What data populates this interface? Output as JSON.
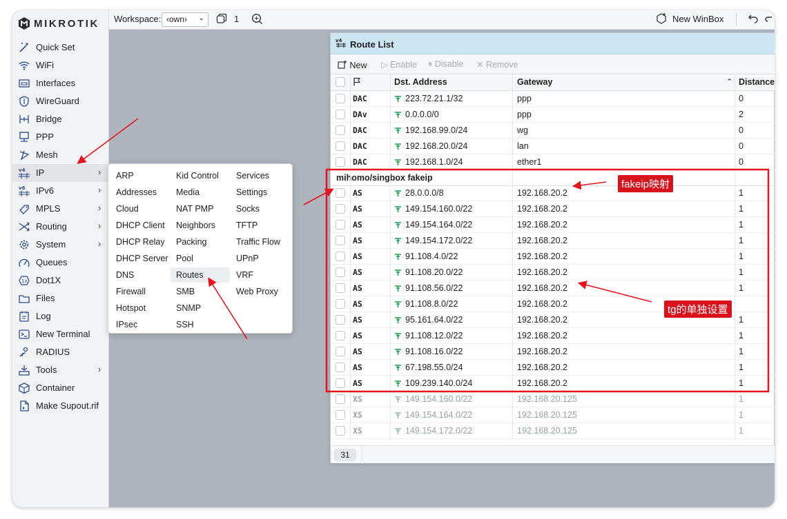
{
  "brand": {
    "name": "MIKROTIK"
  },
  "topbar": {
    "workspace_label": "Workspace:",
    "workspace_value": "‹own›",
    "windows_count": "1",
    "new_winbox": "New WinBox"
  },
  "sidebar": {
    "items": [
      {
        "label": "Quick Set",
        "icon": "quick-set-icon"
      },
      {
        "label": "WiFi",
        "icon": "wifi-icon"
      },
      {
        "label": "Interfaces",
        "icon": "interfaces-icon"
      },
      {
        "label": "WireGuard",
        "icon": "wireguard-icon"
      },
      {
        "label": "Bridge",
        "icon": "bridge-icon"
      },
      {
        "label": "PPP",
        "icon": "ppp-icon"
      },
      {
        "label": "Mesh",
        "icon": "mesh-icon"
      },
      {
        "label": "IP",
        "icon": "ip-icon",
        "submenu": true
      },
      {
        "label": "IPv6",
        "icon": "ipv6-icon",
        "submenu": true
      },
      {
        "label": "MPLS",
        "icon": "mpls-icon",
        "submenu": true
      },
      {
        "label": "Routing",
        "icon": "routing-icon",
        "submenu": true
      },
      {
        "label": "System",
        "icon": "system-icon",
        "submenu": true
      },
      {
        "label": "Queues",
        "icon": "queues-icon"
      },
      {
        "label": "Dot1X",
        "icon": "dot1x-icon"
      },
      {
        "label": "Files",
        "icon": "files-icon"
      },
      {
        "label": "Log",
        "icon": "log-icon"
      },
      {
        "label": "New Terminal",
        "icon": "terminal-icon"
      },
      {
        "label": "RADIUS",
        "icon": "radius-icon"
      },
      {
        "label": "Tools",
        "icon": "tools-icon",
        "submenu": true
      },
      {
        "label": "Container",
        "icon": "container-icon"
      },
      {
        "label": "Make Supout.rif",
        "icon": "supout-icon"
      }
    ]
  },
  "ip_menu": {
    "columns": [
      [
        "ARP",
        "Addresses",
        "Cloud",
        "DHCP Client",
        "DHCP Relay",
        "DHCP Server",
        "DNS",
        "Firewall",
        "Hotspot",
        "IPsec"
      ],
      [
        "Kid Control",
        "Media",
        "NAT PMP",
        "Neighbors",
        "Packing",
        "Pool",
        "Routes",
        "SMB",
        "SNMP",
        "SSH"
      ],
      [
        "Services",
        "Settings",
        "Socks",
        "TFTP",
        "Traffic Flow",
        "UPnP",
        "VRF",
        "Web Proxy"
      ]
    ],
    "highlighted": "Routes"
  },
  "route_list": {
    "title": "Route List",
    "toolbar": {
      "new": "New",
      "enable": "Enable",
      "disable": "Disable",
      "remove": "Remove"
    },
    "columns": {
      "dst": "Dst. Address",
      "gateway": "Gateway",
      "distance": "Distance"
    },
    "rows": [
      {
        "flags": "DAC",
        "dst": "223.72.21.1/32",
        "gateway": "ppp",
        "distance": "0"
      },
      {
        "flags": "DAv",
        "dst": "0.0.0.0/0",
        "gateway": "ppp",
        "distance": "2"
      },
      {
        "flags": "DAC",
        "dst": "192.168.99.0/24",
        "gateway": "wg",
        "distance": "0"
      },
      {
        "flags": "DAC",
        "dst": "192.168.20.0/24",
        "gateway": "lan",
        "distance": "0"
      },
      {
        "flags": "DAC",
        "dst": "192.168.1.0/24",
        "gateway": "ether1",
        "distance": "0"
      }
    ],
    "group": "mihomo/singbox fakeip",
    "group_rows": [
      {
        "flags": "AS",
        "dst": "28.0.0.0/8",
        "gateway": "192.168.20.2",
        "distance": "1"
      },
      {
        "flags": "AS",
        "dst": "149.154.160.0/22",
        "gateway": "192.168.20.2",
        "distance": "1"
      },
      {
        "flags": "AS",
        "dst": "149.154.164.0/22",
        "gateway": "192.168.20.2",
        "distance": "1"
      },
      {
        "flags": "AS",
        "dst": "149.154.172.0/22",
        "gateway": "192.168.20.2",
        "distance": "1"
      },
      {
        "flags": "AS",
        "dst": "91.108.4.0/22",
        "gateway": "192.168.20.2",
        "distance": "1"
      },
      {
        "flags": "AS",
        "dst": "91.108.20.0/22",
        "gateway": "192.168.20.2",
        "distance": "1"
      },
      {
        "flags": "AS",
        "dst": "91.108.56.0/22",
        "gateway": "192.168.20.2",
        "distance": "1"
      },
      {
        "flags": "AS",
        "dst": "91.108.8.0/22",
        "gateway": "192.168.20.2",
        "distance": ""
      },
      {
        "flags": "AS",
        "dst": "95.161.64.0/22",
        "gateway": "192.168.20.2",
        "distance": "1"
      },
      {
        "flags": "AS",
        "dst": "91.108.12.0/22",
        "gateway": "192.168.20.2",
        "distance": "1"
      },
      {
        "flags": "AS",
        "dst": "91.108.16.0/22",
        "gateway": "192.168.20.2",
        "distance": "1"
      },
      {
        "flags": "AS",
        "dst": "67.198.55.0/24",
        "gateway": "192.168.20.2",
        "distance": "1"
      },
      {
        "flags": "AS",
        "dst": "109.239.140.0/24",
        "gateway": "192.168.20.2",
        "distance": "1"
      }
    ],
    "disabled_rows": [
      {
        "flags": "XS",
        "dst": "149.154.160.0/22",
        "gateway": "192.168.20.125",
        "distance": "1"
      },
      {
        "flags": "XS",
        "dst": "149.154.164.0/22",
        "gateway": "192.168.20.125",
        "distance": "1"
      },
      {
        "flags": "XS",
        "dst": "149.154.172.0/22",
        "gateway": "192.168.20.125",
        "distance": "1"
      }
    ],
    "count": "31"
  },
  "annotations": {
    "fakeip": "fakeip映射",
    "tg": "tg的单独设置"
  },
  "colors": {
    "accent_red": "#e5131d",
    "title_bar": "#cde6f5",
    "pin_green": "#1f9d55"
  }
}
